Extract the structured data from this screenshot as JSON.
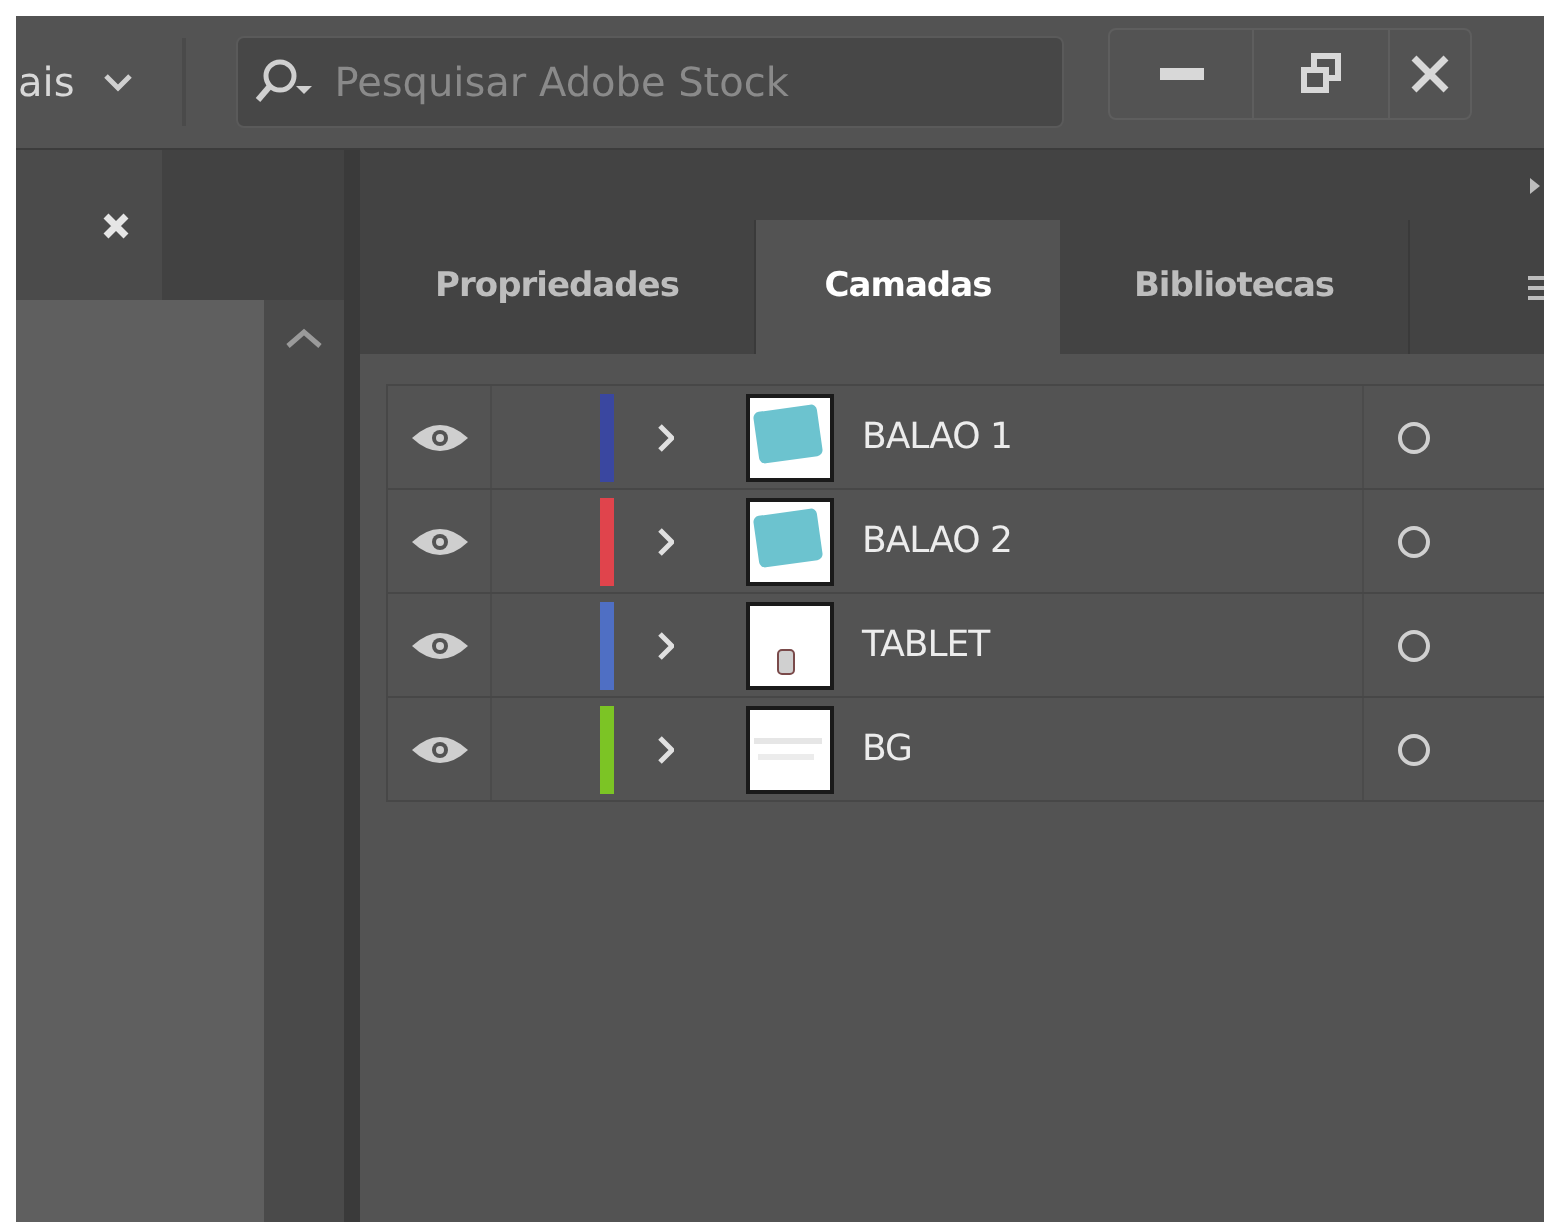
{
  "toolbar": {
    "workspace_label": "ais",
    "search": {
      "placeholder": "Pesquisar Adobe Stock"
    }
  },
  "tabs": [
    {
      "label": "Propriedades",
      "selected": false
    },
    {
      "label": "Camadas",
      "selected": true
    },
    {
      "label": "Bibliotecas",
      "selected": false
    }
  ],
  "layers": [
    {
      "name": "BALAO 1",
      "color": "#3a47a0",
      "visible": true
    },
    {
      "name": "BALAO 2",
      "color": "#e0444c",
      "visible": true
    },
    {
      "name": "TABLET",
      "color": "#4f6fc4",
      "visible": true
    },
    {
      "name": "BG",
      "color": "#7cc425",
      "visible": true
    }
  ]
}
